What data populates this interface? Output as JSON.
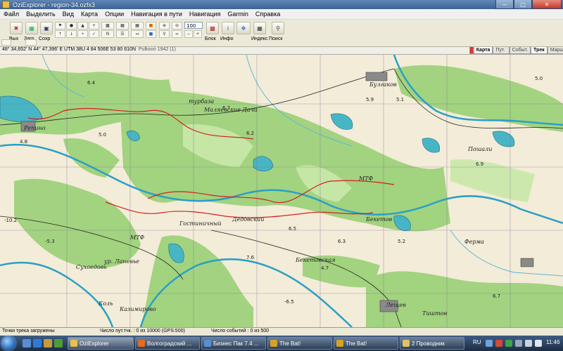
{
  "window": {
    "title": "OziExplorer - region-34.ozfx3"
  },
  "menu": [
    "Файл",
    "Выделить",
    "Вид",
    "Карта",
    "Опции",
    "Навигация в пути",
    "Навигация",
    "Garmin",
    "Справка"
  ],
  "toolbar": {
    "labels": {
      "exit": "Вых",
      "load": "Загр",
      "save": "Сохр",
      "block": "Блок",
      "info": "Инфо",
      "index": "Индекс",
      "search": "Поиск"
    },
    "zoom_value": "100",
    "small_buttons": [
      "1:1",
      "2",
      "3",
      "4",
      "5"
    ],
    "zoom_buttons": [
      "200%",
      "200%",
      "200%",
      "200%",
      "200%"
    ],
    "zoom_sub": [
      "300",
      "100",
      "50",
      "25",
      "FULL"
    ]
  },
  "status": {
    "coords": "48° 34,652' N   44° 47,396' E   UTM 38U   4 84 506E   53 80 610N",
    "datum": "Pulkovo 1942 (1)",
    "tabs": [
      "Карта",
      "Пут. тчк",
      "Событ.",
      "Трек",
      "Маршр"
    ]
  },
  "map_labels": {
    "places": [
      "Репино",
      "Маляевские Дачи",
      "турбаза",
      "Булгаков",
      "Гостиничный",
      "Дедовский",
      "ур. Ланевье",
      "Коль",
      "Казимирово",
      "Бекетовская",
      "Лещев",
      "Тиштов",
      "МТФ",
      "МТФ",
      "Бекетов",
      "Пошали",
      "Ферма",
      "Сухоедовь"
    ],
    "values": [
      "6.4",
      "6.7",
      "6.2",
      "5.9",
      "5.0",
      "4.8",
      "-10.2",
      "6.5",
      "6.3",
      "5.1",
      "5.2",
      "6.9",
      "-6.5",
      "-5.3",
      "5.0",
      "6.7",
      "7.6",
      "4.7"
    ]
  },
  "bottom_status": {
    "track": "Точки трека загружены",
    "waypoints": "Число пут.тчк. : 0 из 10000  (GPS:500)",
    "events": "Число событий : 0 из 500"
  },
  "taskbar": {
    "buttons": [
      "OziExplorer",
      "Волгоградский ...",
      "Бизнес Пак 7.4 ...",
      "The Bat!",
      "The Bat!",
      "2 Проводник"
    ],
    "lang": "RU",
    "time": "11:46"
  }
}
